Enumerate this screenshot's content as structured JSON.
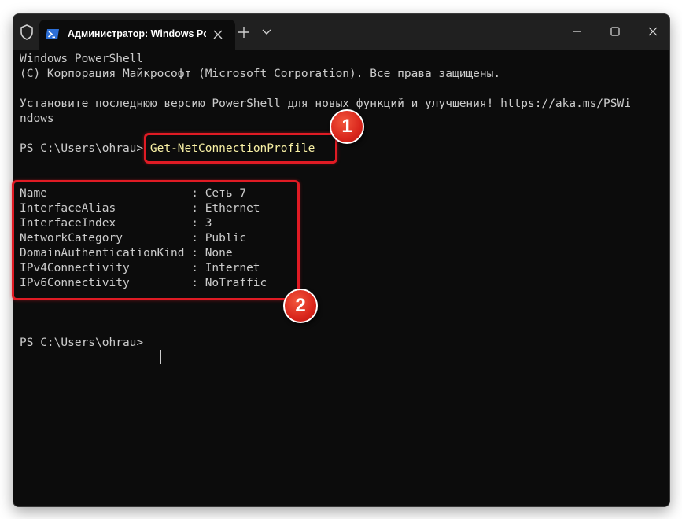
{
  "window": {
    "tab_title": "Администратор: Windows PowerShell",
    "icons": {
      "shield": "shield-icon",
      "tab": "powershell-icon",
      "tab_close": "close-icon",
      "new_tab": "plus-icon",
      "dropdown": "chevron-down-icon",
      "minimize": "minimize-icon",
      "maximize": "maximize-icon",
      "close": "close-icon"
    }
  },
  "terminal": {
    "header_line1": "Windows PowerShell",
    "header_line2": "(C) Корпорация Майкрософт (Microsoft Corporation). Все права защищены.",
    "upgrade_line1": "Установите последнюю версию PowerShell для новых функций и улучшения! https://aka.ms/PSWi",
    "upgrade_line2": "ndows",
    "prompt": "PS C:\\Users\\ohrau> ",
    "command": "Get-NetConnectionProfile",
    "output": [
      "Name                     : Сеть 7",
      "InterfaceAlias           : Ethernet",
      "InterfaceIndex           : 3",
      "NetworkCategory          : Public",
      "DomainAuthenticationKind : None",
      "IPv4Connectivity         : Internet",
      "IPv6Connectivity         : NoTraffic"
    ],
    "final_prompt": "PS C:\\Users\\ohrau> "
  },
  "annotations": {
    "badge1": "1",
    "badge2": "2",
    "color": "#e01b24"
  },
  "colors": {
    "terminal_bg": "#0c0c0c",
    "titlebar_bg": "#202020",
    "text": "#cccccc",
    "command": "#f9f1a5"
  }
}
